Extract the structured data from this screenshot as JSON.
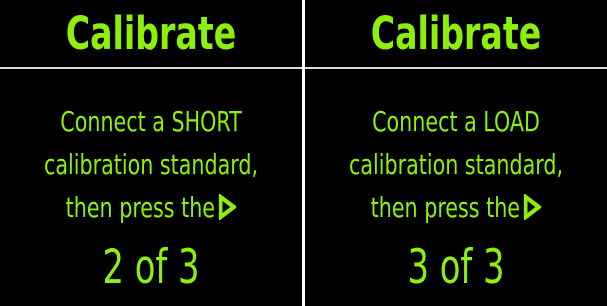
{
  "screens": [
    {
      "title": "Calibrate",
      "message_line1": "Connect a SHORT",
      "message_line2": "calibration standard,",
      "message_line3": "then press the",
      "icon": "play-icon",
      "step": "2 of 3"
    },
    {
      "title": "Calibrate",
      "message_line1": "Connect a LOAD",
      "message_line2": "calibration standard,",
      "message_line3": "then press the",
      "icon": "play-icon",
      "step": "3 of 3"
    }
  ],
  "colors": {
    "text": "#8cf00a",
    "background": "#000000",
    "divider": "#d8d8d8"
  }
}
